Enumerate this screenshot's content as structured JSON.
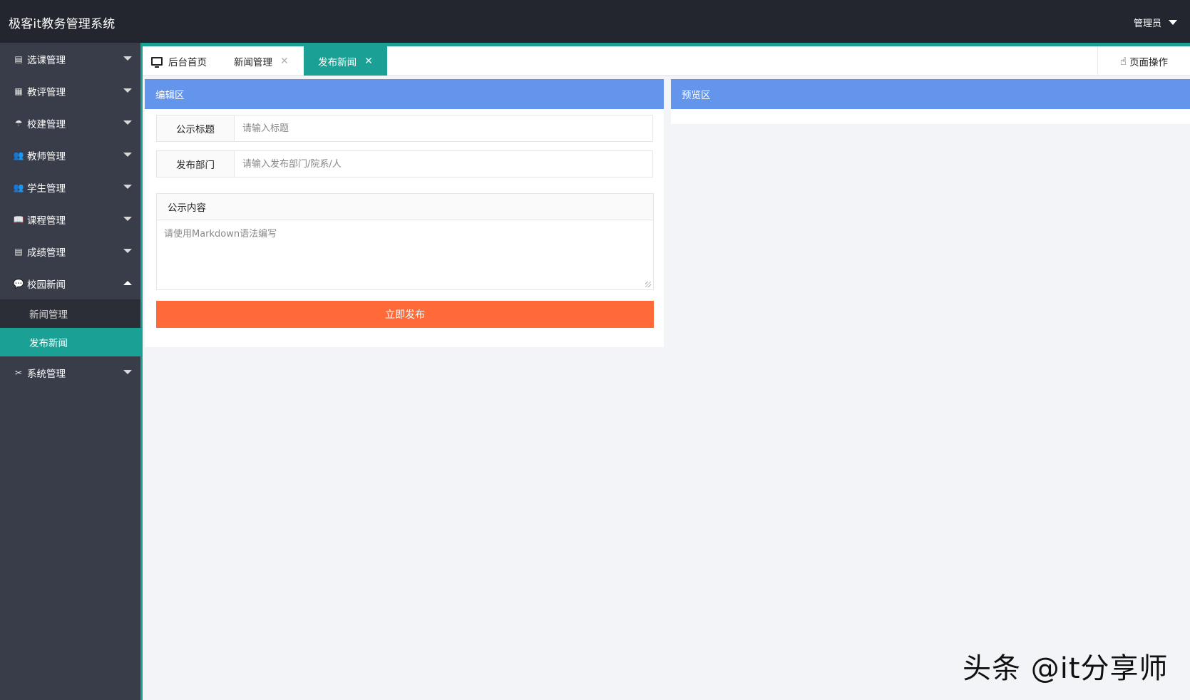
{
  "app": {
    "title": "极客it教务管理系统",
    "user_label": "管理员"
  },
  "sidebar": {
    "items": [
      {
        "label": "选课管理",
        "icon": "document-icon",
        "glyph": "▤"
      },
      {
        "label": "教评管理",
        "icon": "grid-icon",
        "glyph": "▦"
      },
      {
        "label": "校建管理",
        "icon": "umbrella-icon",
        "glyph": "☂"
      },
      {
        "label": "教师管理",
        "icon": "users-icon",
        "glyph": "👥"
      },
      {
        "label": "学生管理",
        "icon": "users-icon",
        "glyph": "👥"
      },
      {
        "label": "课程管理",
        "icon": "book-icon",
        "glyph": "📖"
      },
      {
        "label": "成绩管理",
        "icon": "clipboard-icon",
        "glyph": "▤"
      },
      {
        "label": "校园新闻",
        "icon": "chat-bubble-icon",
        "glyph": "💬",
        "expanded": true,
        "children": [
          {
            "label": "新闻管理"
          },
          {
            "label": "发布新闻",
            "active": true
          }
        ]
      },
      {
        "label": "系统管理",
        "icon": "tools-icon",
        "glyph": "✂"
      }
    ]
  },
  "tabs": [
    {
      "label": "后台首页",
      "icon": "monitor-icon"
    },
    {
      "label": "新闻管理",
      "closable": true
    },
    {
      "label": "发布新闻",
      "closable": true,
      "active": true
    }
  ],
  "page_ops": {
    "label": "页面操作",
    "icon": "hand-pointer-icon",
    "glyph": "☝"
  },
  "editor": {
    "panel_title": "编辑区",
    "title_label": "公示标题",
    "title_placeholder": "请输入标题",
    "title_value": "",
    "dept_label": "发布部门",
    "dept_placeholder": "请输入发布部门/院系/人",
    "dept_value": "",
    "content_label": "公示内容",
    "content_placeholder": "请使用Markdown语法编写",
    "content_value": "",
    "submit_label": "立即发布"
  },
  "preview": {
    "panel_title": "预览区"
  },
  "watermark": "头条 @it分享师",
  "colors": {
    "header": "#23262e",
    "sidebar": "#393d49",
    "accent": "#1aa094",
    "panel_head": "#6495ed",
    "button": "#ff6a38"
  }
}
